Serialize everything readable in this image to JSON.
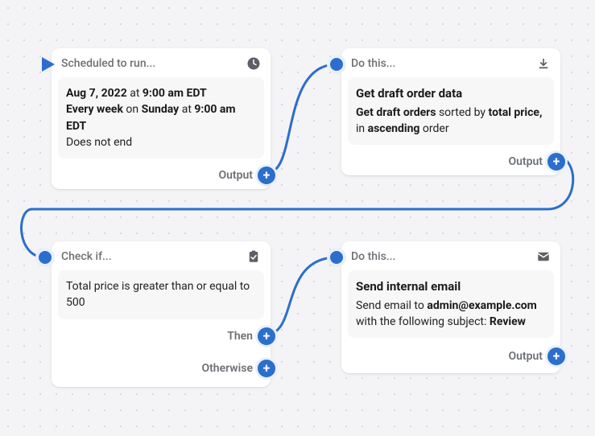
{
  "nodes": {
    "trigger": {
      "header": "Scheduled to run...",
      "date": "Aug 7, 2022",
      "at1": " at ",
      "time1": "9:00 am EDT",
      "recur1": "Every week",
      "on": " on ",
      "day": "Sunday",
      "at2": " at ",
      "time2": "9:00 am EDT",
      "end": "Does not end",
      "output": "Output"
    },
    "action1": {
      "header": "Do this...",
      "title": "Get draft order data",
      "p1a": "Get draft orders",
      "p1b": " sorted by ",
      "p1c": "total price,",
      "p1d": " in ",
      "p1e": "ascending",
      "p1f": " order",
      "output": "Output"
    },
    "cond": {
      "header": "Check if...",
      "body": "Total price is greater than or equal to 500",
      "then": "Then",
      "else": "Otherwise"
    },
    "action2": {
      "header": "Do this...",
      "title": "Send internal email",
      "p2a": "Send email to ",
      "p2b": "admin@example.com",
      "p2c": " with the following subject: ",
      "p2d": "Review",
      "output": "Output"
    }
  }
}
